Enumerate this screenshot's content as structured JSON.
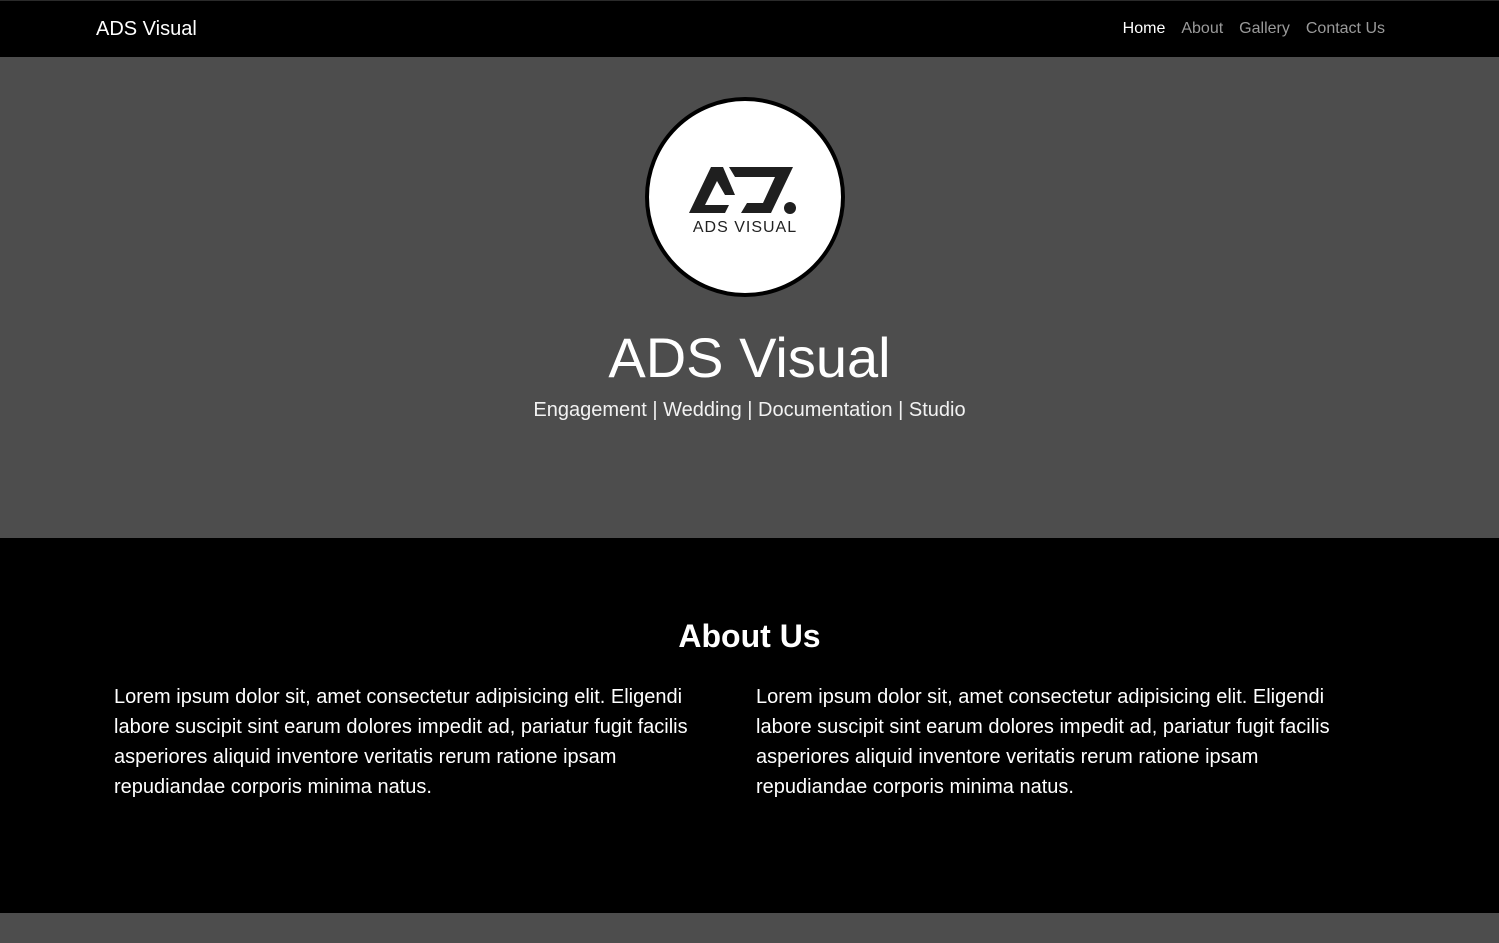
{
  "navbar": {
    "brand": "ADS Visual",
    "links": [
      {
        "label": "Home",
        "active": true
      },
      {
        "label": "About",
        "active": false
      },
      {
        "label": "Gallery",
        "active": false
      },
      {
        "label": "Contact Us",
        "active": false
      }
    ]
  },
  "hero": {
    "logo_text": "ADS VISUAL",
    "title": "ADS Visual",
    "subtitle": "Engagement | Wedding | Documentation | Studio"
  },
  "about": {
    "title": "About Us",
    "paragraphs": [
      "Lorem ipsum dolor sit, amet consectetur adipisicing elit. Eligendi labore suscipit sint earum dolores impedit ad, pariatur fugit facilis asperiores aliquid inventore veritatis rerum ratione ipsam repudiandae corporis minima natus.",
      "Lorem ipsum dolor sit, amet consectetur adipisicing elit. Eligendi labore suscipit sint earum dolores impedit ad, pariatur fugit facilis asperiores aliquid inventore veritatis rerum ratione ipsam repudiandae corporis minima natus."
    ]
  },
  "colors": {
    "navbar_bg": "#000000",
    "hero_bg": "#4d4d4d",
    "about_bg": "#000000",
    "nav_active": "#ffffff",
    "nav_inactive": "#9a9a9a"
  }
}
